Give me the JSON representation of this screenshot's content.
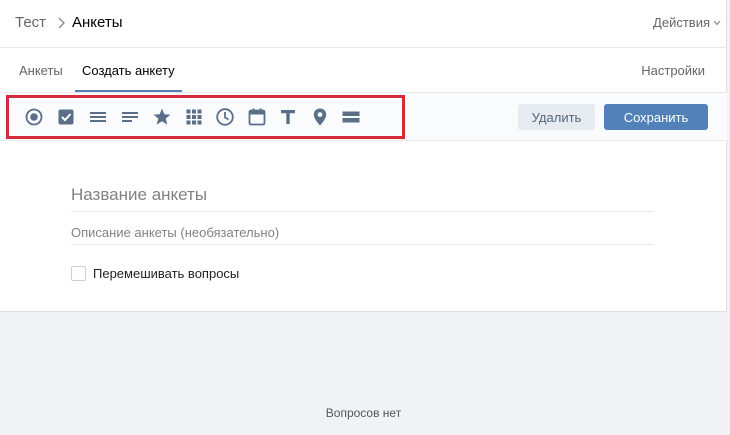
{
  "breadcrumb": {
    "root": "Тест",
    "current": "Анкеты"
  },
  "header": {
    "actions_label": "Действия"
  },
  "tabs": [
    {
      "label": "Анкеты",
      "active": false
    },
    {
      "label": "Создать анкету",
      "active": true
    }
  ],
  "settings_label": "Настройки",
  "toolbar": {
    "tools": [
      "radio-icon",
      "checkbox-icon",
      "list-icon",
      "text-lines-icon",
      "star-icon",
      "grid-icon",
      "clock-icon",
      "calendar-icon",
      "text-t-icon",
      "location-icon",
      "divider-icon"
    ],
    "delete_label": "Удалить",
    "save_label": "Сохранить",
    "accent_color": "#5181b8",
    "icon_color": "#5a6e88",
    "highlight_color": "#d42b3a"
  },
  "form": {
    "title_placeholder": "Название анкеты",
    "description_placeholder": "Описание анкеты (необязательно)",
    "shuffle_label": "Перемешивать вопросы",
    "shuffle_checked": false
  },
  "empty_state": "Вопросов нет"
}
